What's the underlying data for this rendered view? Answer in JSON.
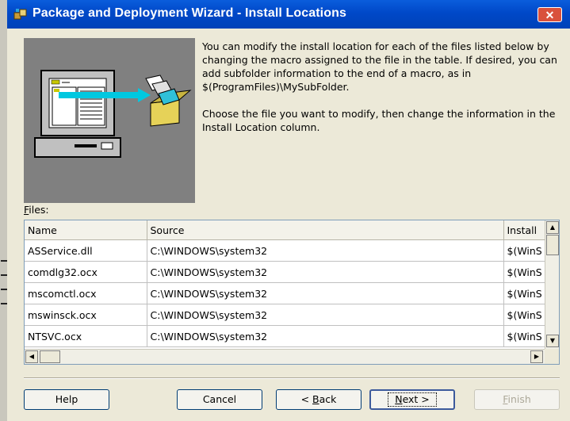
{
  "window": {
    "title": "Package and Deployment Wizard - Install Locations",
    "close_label": "✕"
  },
  "description": {
    "paragraph1": "You can modify the install location for each of the files listed below by changing the macro assigned to the file in the table. If desired, you can add subfolder information to the end of a macro, as in $(ProgramFiles)\\MySubFolder.",
    "paragraph2": "Choose the file you want to modify, then change the information in the Install Location column."
  },
  "files_label": {
    "mnemonic": "F",
    "rest": "iles:"
  },
  "table": {
    "columns": [
      "Name",
      "Source",
      "Install"
    ],
    "rows": [
      [
        "ASService.dll",
        "C:\\WINDOWS\\system32",
        "$(WinS"
      ],
      [
        "comdlg32.ocx",
        "C:\\WINDOWS\\system32",
        "$(WinS"
      ],
      [
        "mscomctl.ocx",
        "C:\\WINDOWS\\system32",
        "$(WinS"
      ],
      [
        "mswinsck.ocx",
        "C:\\WINDOWS\\system32",
        "$(WinS"
      ],
      [
        "NTSVC.ocx",
        "C:\\WINDOWS\\system32",
        "$(WinS"
      ]
    ]
  },
  "buttons": {
    "help": "Help",
    "cancel": "Cancel",
    "back": {
      "prefix": "< ",
      "mnemonic": "B",
      "rest": "ack"
    },
    "next": {
      "mnemonic": "N",
      "rest": "ext >"
    },
    "finish": {
      "mnemonic": "F",
      "rest": "inish"
    }
  },
  "colors": {
    "titlebar": "#0048c8",
    "dialog_bg": "#ece9d8",
    "close_button": "#d9513c"
  }
}
